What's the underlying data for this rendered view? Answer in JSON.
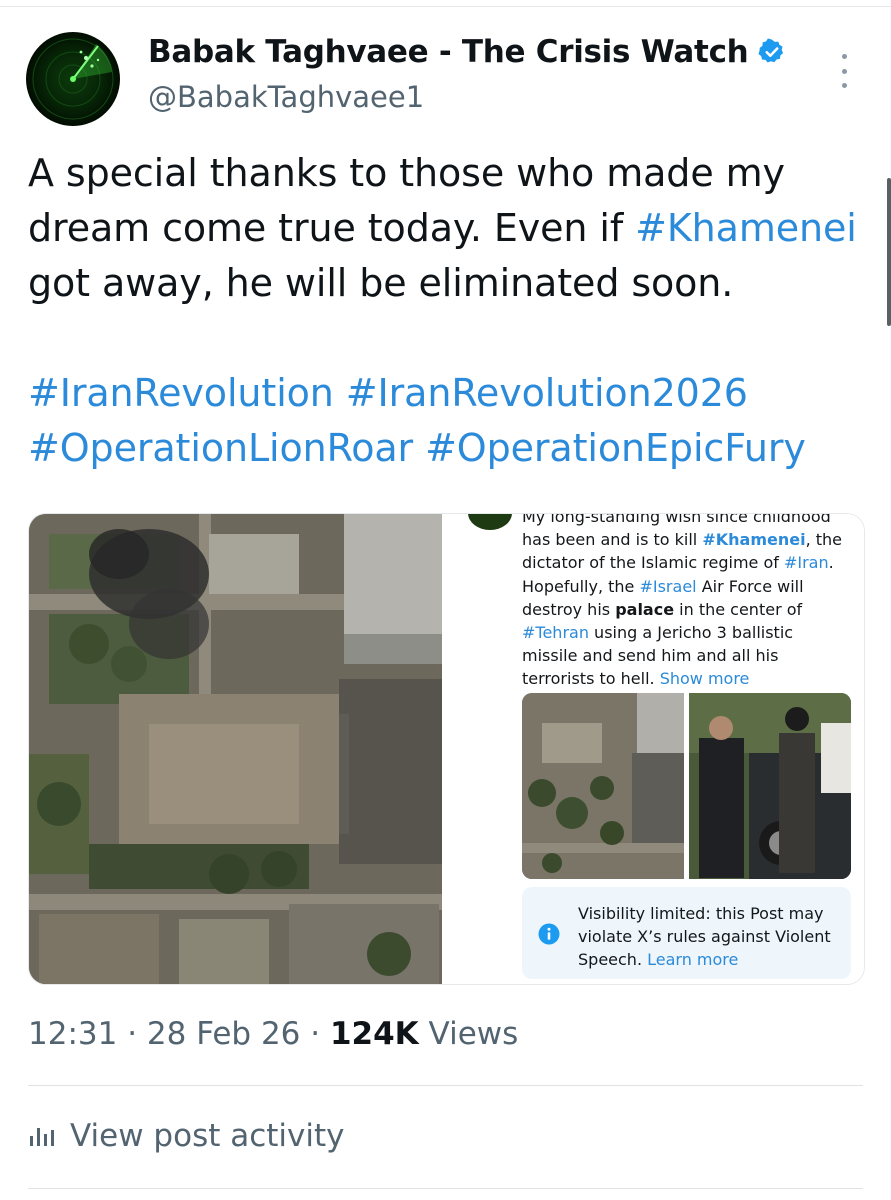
{
  "author": {
    "name": "Babak Taghvaee - The Crisis Watch",
    "handle": "@BabakTaghvaee1",
    "avatar_icon": "radar-icon",
    "verified_icon": "verified-badge-icon",
    "more_icon": "more-vertical-icon"
  },
  "tweet": {
    "line1_text": "A special thanks to those who made my dream come true today. Even if ",
    "line1_tag": "#Khamenei",
    "line1_after": " got away, he will be eliminated soon.",
    "tags": {
      "t1": "#IranRevolution",
      "t2": "#IranRevolution2026",
      "t3": "#OperationLionRoar",
      "t4": "#OperationEpicFury"
    }
  },
  "embedded_post": {
    "p1": "My long-standing wish since childhood has been and is to kill ",
    "tag_khamenei": "#Khamenei",
    "p2": ", the dictator of the Islamic regime of ",
    "tag_iran": "#Iran",
    "p3": ". Hopefully, the ",
    "tag_israel": "#Israel",
    "p4": " Air Force will destroy his ",
    "bold_palace": "palace",
    "p5": " in the center of ",
    "tag_tehran": "#Tehran",
    "p6": " using a Jericho 3 ballistic missile and send him and all his terrorists to hell. ",
    "show_more": "Show more",
    "notice_text": "Visibility limited: this Post may violate X’s rules against Violent Speech. ",
    "learn_more": "Learn more",
    "notice_icon": "info-icon"
  },
  "meta": {
    "time": "12:31",
    "sep1": " · ",
    "date": "28 Feb 26",
    "sep2": " · ",
    "views_count": "124K",
    "views_label": " Views"
  },
  "activity": {
    "label": "View post activity",
    "icon": "bar-chart-icon"
  },
  "colors": {
    "link": "#2b8ad9",
    "verified": "#1d9bf0",
    "muted": "#536471",
    "notice_bg": "#eef6fb"
  }
}
